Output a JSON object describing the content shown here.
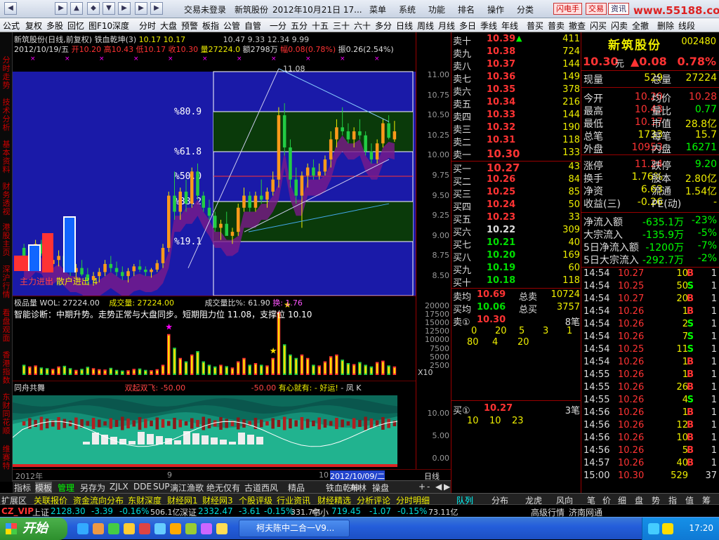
{
  "titlebar": {
    "nav": [
      "◀",
      "▶",
      "▲",
      "◆",
      "▼",
      "▶",
      "▶",
      "▶"
    ],
    "login": "交易未登录",
    "stock": "新筑股份",
    "date": "2012年10月21日 17...",
    "menus": [
      "菜单",
      "系统",
      "功能",
      "排名",
      "操作",
      "分类"
    ],
    "btn1": "闪电手",
    "btn2": "交易",
    "btn3": "资讯",
    "logo": "www.55188.com"
  },
  "toolbar": {
    "items": [
      "公式",
      "复权",
      "多股",
      "回忆",
      "图F10",
      "深度",
      "分时",
      "大盘",
      "预警",
      "板指",
      "公管",
      "自管",
      "一分",
      "五分",
      "十五",
      "三十",
      "六十",
      "多分",
      "日线",
      "周线",
      "月线",
      "多日",
      "季线",
      "年线",
      "普买",
      "普卖",
      "撤查",
      "闪买",
      "闪卖",
      "全撤",
      "删除",
      "线段"
    ]
  },
  "leftside": [
    "分时走势",
    "技术分析",
    "基本资料",
    "财务透视",
    "港股主页",
    "深沪行情",
    "看盘观面",
    "香港指数",
    "东财同花顺",
    "维赛特"
  ],
  "kchart": {
    "header": "新筑股份(日线,前复权) 铁血乾坤(3)",
    "ma_vals": "10.17 10.17",
    "ma_vals2": "10.47  9.33  12.34  9.99",
    "date": "2012/10/19/五",
    "open": "开10.20",
    "high": "高10.43",
    "low": "低10.17",
    "close": "收10.30",
    "vol": "量27224.0",
    "amt": "额2798万",
    "chg": "幅0.08(0.78%)",
    "amp": "振0.26(2.54%)",
    "peak": "11.08",
    "fibs": [
      "%80.9",
      "%61.8",
      "%50.0",
      "%38.2",
      "%19.1"
    ],
    "legend1": "主力进出",
    "legend2": "散户进出",
    "legend3": "4"
  },
  "axis": {
    "labels": [
      "11.00",
      "10.75",
      "10.50",
      "10.25",
      "10.00",
      "9.75",
      "9.50",
      "9.25",
      "9.00",
      "8.75",
      "8.50"
    ],
    "vol_labels": [
      "20000",
      "17500",
      "15000",
      "12500",
      "10000",
      "7500",
      "5000",
      "2500"
    ],
    "x10": "X10",
    "ind_labels": [
      "10.00",
      "5.00",
      "0.00"
    ]
  },
  "volpanel": {
    "title": "极品量 WOL: 27224.00",
    "cjl": "成交量: 27224.00",
    "ratio": "成交量比%: 61.90",
    "huan": "换: 1.76",
    "diag": "智能诊断：中期升势。走势正常与大盘同步。短期阻力位 11.08，支撑位 10.10"
  },
  "indpanel": {
    "title": "同舟共舞",
    "sg": "双起双飞: -50.00",
    "v2": "-50.00",
    "yx": "有心就有:",
    "hy": "- 好运!",
    "fk": "- 凤 K"
  },
  "timeaxis": {
    "year": "2012年",
    "m9": "9",
    "m10": "10",
    "cur": "2012/10/09/二",
    "rx": "日线"
  },
  "bottomtabs": [
    "指标",
    "模板",
    "管理",
    "另存为",
    "ZJLX",
    "DDE",
    "SUP",
    "漓江渔歌",
    "绝无仅有",
    "古道西风",
    "精品",
    "铁血乾坤",
    "布林",
    "操盘"
  ],
  "bottomtabs2": [
    "扩展区",
    "关联报价",
    "资金流向分布",
    "东财深度",
    "财经网1",
    "财经网3",
    "个股评级",
    "行业资讯",
    "财经精选",
    "分析评论",
    "分时明细"
  ],
  "orderbook": {
    "sells": [
      {
        "l": "卖十",
        "p": "10.39",
        "v": "411"
      },
      {
        "l": "卖九",
        "p": "10.38",
        "v": "724"
      },
      {
        "l": "卖八",
        "p": "10.37",
        "v": "144"
      },
      {
        "l": "卖七",
        "p": "10.36",
        "v": "149"
      },
      {
        "l": "卖六",
        "p": "10.35",
        "v": "378"
      },
      {
        "l": "卖五",
        "p": "10.34",
        "v": "216"
      },
      {
        "l": "卖四",
        "p": "10.33",
        "v": "144"
      },
      {
        "l": "卖三",
        "p": "10.32",
        "v": "190"
      },
      {
        "l": "卖二",
        "p": "10.31",
        "v": "118"
      },
      {
        "l": "卖一",
        "p": "10.30",
        "v": "133"
      }
    ],
    "buys": [
      {
        "l": "买一",
        "p": "10.27",
        "v": "43"
      },
      {
        "l": "买二",
        "p": "10.26",
        "v": "84"
      },
      {
        "l": "买三",
        "p": "10.25",
        "v": "85"
      },
      {
        "l": "买四",
        "p": "10.24",
        "v": "50"
      },
      {
        "l": "买五",
        "p": "10.23",
        "v": "33"
      },
      {
        "l": "买六",
        "p": "10.22",
        "v": "309"
      },
      {
        "l": "买七",
        "p": "10.21",
        "v": "40"
      },
      {
        "l": "买八",
        "p": "10.20",
        "v": "169"
      },
      {
        "l": "买九",
        "p": "10.19",
        "v": "60"
      },
      {
        "l": "买十",
        "p": "10.18",
        "v": "118"
      }
    ],
    "avgsell": "10.69",
    "totsell": "10724",
    "avgbuy": "10.06",
    "totbuy": "3757",
    "s1": "10.30",
    "s1n": "8笔",
    "s1q": [
      "0",
      "20",
      "5",
      "3",
      "1"
    ],
    "s1q2": [
      "80",
      "4",
      "20"
    ],
    "b1": "10.27",
    "b1n": "3笔",
    "b1q": [
      "10",
      "10",
      "23"
    ],
    "lab_avgsell": "卖均",
    "lab_totsell": "总卖",
    "lab_avgbuy": "买均",
    "lab_totbuy": "总买",
    "lab_s1": "卖①",
    "lab_b1": "买①"
  },
  "quote": {
    "name": "新筑股份",
    "code": "002480",
    "price": "10.30",
    "unit": "元",
    "chg": "▲0.08",
    "pct": "0.78%",
    "rows": [
      [
        "现量",
        "529",
        "总量",
        "27224"
      ],
      [
        "今开",
        "10.20",
        "均价",
        "10.28"
      ],
      [
        "最高",
        "10.43",
        "量比",
        "0.77"
      ],
      [
        "最低",
        "10.17",
        "市值",
        "28.8亿"
      ],
      [
        "总笔",
        "1733",
        "每笔",
        "15.7"
      ],
      [
        "外盘",
        "10953",
        "内盘",
        "16271"
      ],
      [
        "涨停",
        "11.24",
        "跌停",
        "9.20"
      ],
      [
        "换手",
        "1.76%",
        "股本",
        "2.80亿"
      ],
      [
        "净资",
        "6.63",
        "流通",
        "1.54亿"
      ],
      [
        "收益(三)",
        "-0.26",
        "PE(动)",
        "-"
      ]
    ],
    "flows": [
      [
        "净流入额",
        "-635.1万",
        "-23%"
      ],
      [
        "大宗流入",
        "-135.9万",
        "-5%"
      ],
      [
        "5日净流入额",
        "-1200万",
        "-7%"
      ],
      [
        "5日大宗流入",
        "-292.7万",
        "-2%"
      ]
    ],
    "ticks": [
      [
        "14:54",
        "10.27",
        "10",
        "B"
      ],
      [
        "14:54",
        "10.25",
        "50",
        "S"
      ],
      [
        "14:54",
        "10.27",
        "20",
        "B"
      ],
      [
        "14:54",
        "10.26",
        "1",
        "B"
      ],
      [
        "14:54",
        "10.26",
        "2",
        "S"
      ],
      [
        "14:54",
        "10.26",
        "7",
        "S"
      ],
      [
        "14:54",
        "10.25",
        "11",
        "S"
      ],
      [
        "14:54",
        "10.26",
        "1",
        "B"
      ],
      [
        "14:55",
        "10.26",
        "1",
        "B"
      ],
      [
        "14:55",
        "10.26",
        "26",
        "B"
      ],
      [
        "14:55",
        "10.26",
        "4",
        "S"
      ],
      [
        "14:56",
        "10.26",
        "1",
        "B"
      ],
      [
        "14:56",
        "10.26",
        "12",
        "B"
      ],
      [
        "14:56",
        "10.26",
        "10",
        "B"
      ],
      [
        "14:56",
        "10.26",
        "5",
        "B"
      ],
      [
        "14:57",
        "10.26",
        "40",
        "B"
      ],
      [
        "15:00",
        "10.30",
        "529",
        ""
      ]
    ],
    "tick_idx": [
      "1",
      "1",
      "1",
      "1",
      "1",
      "1",
      "1",
      "1",
      "1",
      "1",
      "1",
      "1",
      "1",
      "1",
      "1",
      "1",
      "37"
    ]
  },
  "rtabs": [
    "队列",
    "分布",
    "龙虎",
    "风向",
    "笔",
    "价",
    "细",
    "盘",
    "势",
    "指",
    "值",
    "筹"
  ],
  "statusbar": {
    "app": "CZ_VIP",
    "sh": "上证",
    "sh_v": "2128.30",
    "sh_c": "-3.39",
    "sh_p": "-0.16%",
    "sh_a": "506.1亿",
    "sz": "深证",
    "sz_v": "2332.47",
    "sz_c": "-3.61",
    "sz_p": "-0.15%",
    "sz_a": "331.7亿",
    "zx": "中小",
    "zx_v": "719.45",
    "zx_c": "-1.07",
    "zx_p": "-0.15%",
    "zx_a": "73.11亿",
    "gj": "高级行情_济南网通"
  },
  "taskbar": {
    "start": "开始",
    "app": "柯夫陈中二合一V9...",
    "clock": "17:20"
  },
  "colors": {
    "up": "#ff3333",
    "down": "#00dddd",
    "yellow": "#eeee00",
    "blue_bg": "#1a1aa8",
    "green": "#22cc22"
  },
  "chart_data": [
    {
      "type": "candlestick",
      "title": "新筑股份(日线,前复权)",
      "ylim": [
        8.3,
        11.2
      ],
      "x": [
        "c1",
        "c2",
        "c3",
        "c4",
        "c5",
        "c6",
        "c7",
        "c8",
        "c9",
        "c10",
        "c11",
        "c12",
        "c13",
        "c14",
        "c15",
        "c16",
        "c17",
        "c18",
        "c19",
        "c20",
        "c21",
        "c22",
        "c23",
        "c24",
        "c25",
        "c26",
        "c27",
        "c28",
        "c29",
        "c30",
        "c31",
        "c32",
        "c33",
        "c34",
        "c35",
        "c36",
        "c37",
        "c38",
        "c39",
        "c40",
        "c41",
        "c42",
        "c43",
        "c44",
        "c45",
        "c46",
        "c47",
        "c48",
        "c49",
        "c50",
        "c51",
        "c52",
        "c53",
        "c54",
        "c55",
        "c56",
        "c57",
        "c58",
        "c59",
        "c60",
        "c61",
        "c62",
        "c63",
        "c64",
        "c65"
      ],
      "ohlc": [
        [
          8.85,
          8.9,
          8.65,
          8.7
        ],
        [
          8.72,
          8.85,
          8.6,
          8.8
        ],
        [
          8.8,
          8.95,
          8.7,
          8.9
        ],
        [
          8.9,
          8.95,
          8.75,
          8.78
        ],
        [
          8.78,
          8.85,
          8.6,
          8.65
        ],
        [
          8.65,
          8.75,
          8.55,
          8.7
        ],
        [
          8.7,
          8.82,
          8.62,
          8.75
        ],
        [
          8.75,
          8.8,
          8.6,
          8.62
        ],
        [
          8.62,
          8.7,
          8.5,
          8.55
        ],
        [
          8.55,
          8.65,
          8.45,
          8.6
        ],
        [
          8.6,
          8.7,
          8.5,
          8.52
        ],
        [
          8.52,
          8.6,
          8.4,
          8.45
        ],
        [
          8.45,
          8.55,
          8.38,
          8.5
        ],
        [
          8.5,
          8.6,
          8.42,
          8.55
        ],
        [
          8.55,
          8.7,
          8.5,
          8.65
        ],
        [
          8.65,
          8.75,
          8.55,
          8.6
        ],
        [
          8.6,
          8.68,
          8.5,
          8.55
        ],
        [
          8.55,
          8.62,
          8.45,
          8.5
        ],
        [
          8.5,
          8.6,
          8.42,
          8.56
        ],
        [
          8.56,
          8.65,
          8.5,
          8.62
        ],
        [
          8.62,
          8.7,
          8.55,
          8.58
        ],
        [
          8.58,
          8.62,
          8.5,
          8.55
        ],
        [
          8.55,
          8.6,
          8.48,
          8.58
        ],
        [
          8.58,
          8.7,
          8.55,
          8.66
        ],
        [
          8.66,
          8.9,
          8.6,
          8.85
        ],
        [
          8.85,
          9.55,
          8.8,
          9.5
        ],
        [
          9.5,
          9.8,
          9.2,
          9.3
        ],
        [
          9.3,
          9.6,
          9.2,
          9.55
        ],
        [
          9.55,
          9.7,
          9.3,
          9.4
        ],
        [
          9.4,
          9.85,
          9.35,
          9.8
        ],
        [
          9.8,
          9.9,
          9.45,
          9.5
        ],
        [
          9.5,
          9.55,
          9.3,
          9.35
        ],
        [
          9.35,
          9.45,
          9.2,
          9.25
        ],
        [
          9.25,
          9.3,
          9.05,
          9.1
        ],
        [
          9.1,
          9.2,
          8.95,
          9.15
        ],
        [
          9.15,
          9.3,
          9.05,
          9.0
        ],
        [
          9.0,
          9.1,
          8.9,
          9.05
        ],
        [
          9.05,
          9.4,
          9.0,
          9.35
        ],
        [
          9.35,
          9.6,
          9.3,
          9.5
        ],
        [
          9.5,
          9.55,
          9.3,
          9.35
        ],
        [
          9.35,
          9.55,
          9.3,
          9.5
        ],
        [
          9.5,
          9.7,
          9.4,
          9.45
        ],
        [
          9.45,
          9.6,
          9.35,
          9.55
        ],
        [
          9.55,
          9.8,
          9.5,
          9.7
        ],
        [
          9.7,
          10.6,
          9.6,
          10.5
        ],
        [
          10.5,
          10.65,
          10.0,
          10.1
        ],
        [
          10.1,
          10.2,
          9.6,
          9.7
        ],
        [
          9.7,
          9.85,
          9.4,
          9.5
        ],
        [
          9.5,
          9.8,
          9.1,
          9.75
        ],
        [
          9.75,
          9.9,
          9.6,
          9.85
        ],
        [
          9.85,
          9.95,
          9.7,
          9.75
        ],
        [
          9.75,
          9.9,
          9.7,
          9.8
        ],
        [
          9.8,
          10.0,
          9.75,
          9.95
        ],
        [
          9.95,
          10.3,
          9.85,
          10.2
        ],
        [
          10.2,
          10.45,
          10.1,
          10.35
        ],
        [
          10.35,
          10.6,
          10.25,
          10.3
        ],
        [
          10.3,
          10.4,
          10.15,
          10.2
        ],
        [
          10.2,
          10.35,
          10.1,
          10.3
        ],
        [
          10.3,
          10.45,
          10.2,
          10.25
        ],
        [
          10.25,
          10.3,
          10.0,
          10.05
        ],
        [
          10.05,
          10.15,
          9.9,
          9.95
        ],
        [
          9.95,
          10.2,
          9.9,
          10.15
        ],
        [
          10.15,
          10.45,
          10.1,
          10.4
        ],
        [
          10.4,
          10.5,
          10.2,
          10.22
        ],
        [
          10.2,
          10.43,
          10.17,
          10.3
        ]
      ],
      "annotations": [
        "11.08"
      ],
      "fib_levels": [
        "%80.9",
        "%61.8",
        "%50.0",
        "%38.2",
        "%19.1"
      ]
    },
    {
      "type": "bar",
      "title": "极品量 WOL",
      "ylim": [
        0,
        21000
      ],
      "series": [
        {
          "name": "成交量",
          "values": [
            3000,
            2500,
            2800,
            2200,
            2000,
            1800,
            2500,
            2700,
            2000,
            1500,
            1800,
            2400,
            2000,
            1700,
            1600,
            2100,
            1500,
            1300,
            1400,
            1800,
            1900,
            1500,
            1400,
            1700,
            3000,
            12000,
            8000,
            5000,
            4000,
            6000,
            7000,
            4000,
            3000,
            2500,
            3000,
            2600,
            2200,
            4000,
            5000,
            3000,
            3500,
            3000,
            2800,
            5000,
            18500,
            9000,
            6000,
            5000,
            6000,
            5000,
            3000,
            2800,
            4000,
            5500,
            6000,
            4500,
            3500,
            3200,
            3800,
            3000,
            2500,
            3800,
            4200,
            2800,
            2500
          ]
        }
      ]
    }
  ]
}
